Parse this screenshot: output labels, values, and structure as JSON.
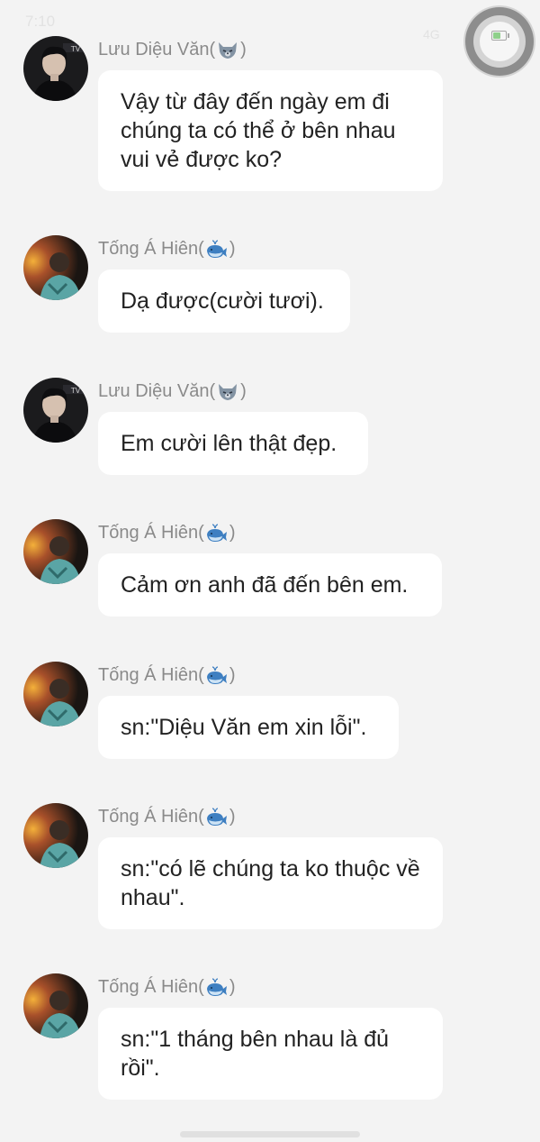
{
  "status_bar": {
    "time": "7:10",
    "right_text": "4G"
  },
  "colors": {
    "background": "#f3f3f3",
    "bubble": "#ffffff",
    "sender_name": "#8a8a8a",
    "message_text": "#222222"
  },
  "messages": [
    {
      "sender": "Lưu Diệu Văn",
      "sender_icon": "wolf-icon",
      "avatar": "boy-portrait",
      "text": "Vậy từ đây đến ngày em đi chúng ta có thể ở bên nhau vui vẻ được ko?"
    },
    {
      "sender": "Tống Á Hiên",
      "sender_icon": "whale-icon",
      "avatar": "sunset-portrait",
      "text": "Dạ được(cười tươi)."
    },
    {
      "sender": "Lưu Diệu Văn",
      "sender_icon": "wolf-icon",
      "avatar": "boy-portrait",
      "text": "Em cười lên thật đẹp."
    },
    {
      "sender": "Tống Á Hiên",
      "sender_icon": "whale-icon",
      "avatar": "sunset-portrait",
      "text": "Cảm ơn anh đã đến bên em."
    },
    {
      "sender": "Tống Á Hiên",
      "sender_icon": "whale-icon",
      "avatar": "sunset-portrait",
      "text": "sn:\"Diệu Văn em xin lỗi\"."
    },
    {
      "sender": "Tống Á Hiên",
      "sender_icon": "whale-icon",
      "avatar": "sunset-portrait",
      "text": "sn:\"có lẽ chúng ta ko thuộc về nhau\"."
    },
    {
      "sender": "Tống Á Hiên",
      "sender_icon": "whale-icon",
      "avatar": "sunset-portrait",
      "text": "sn:\"1 tháng bên nhau là đủ rồi\"."
    }
  ]
}
